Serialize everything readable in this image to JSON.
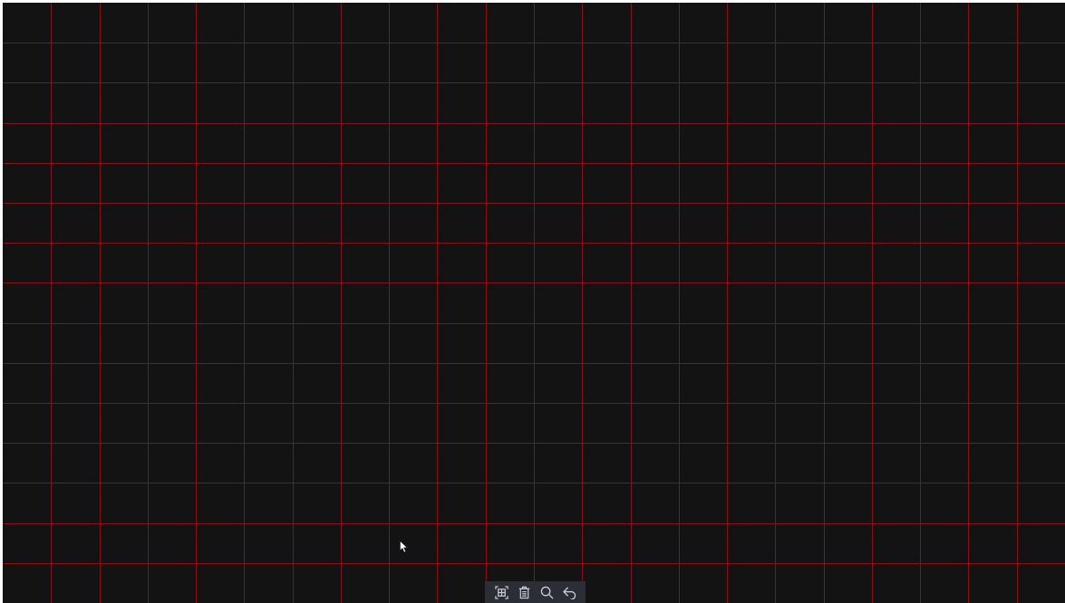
{
  "grid": {
    "columns": 22,
    "rows": 15,
    "line_color": "#8a0f16",
    "cell_color": "#131314"
  },
  "toolbar": {
    "background": "#2b2f35",
    "icon_color": "#c9ced6",
    "buttons": [
      {
        "name": "select-all-icon"
      },
      {
        "name": "delete-icon"
      },
      {
        "name": "zoom-icon"
      },
      {
        "name": "undo-icon"
      }
    ]
  },
  "cursor": {
    "color": "#ffffff"
  }
}
